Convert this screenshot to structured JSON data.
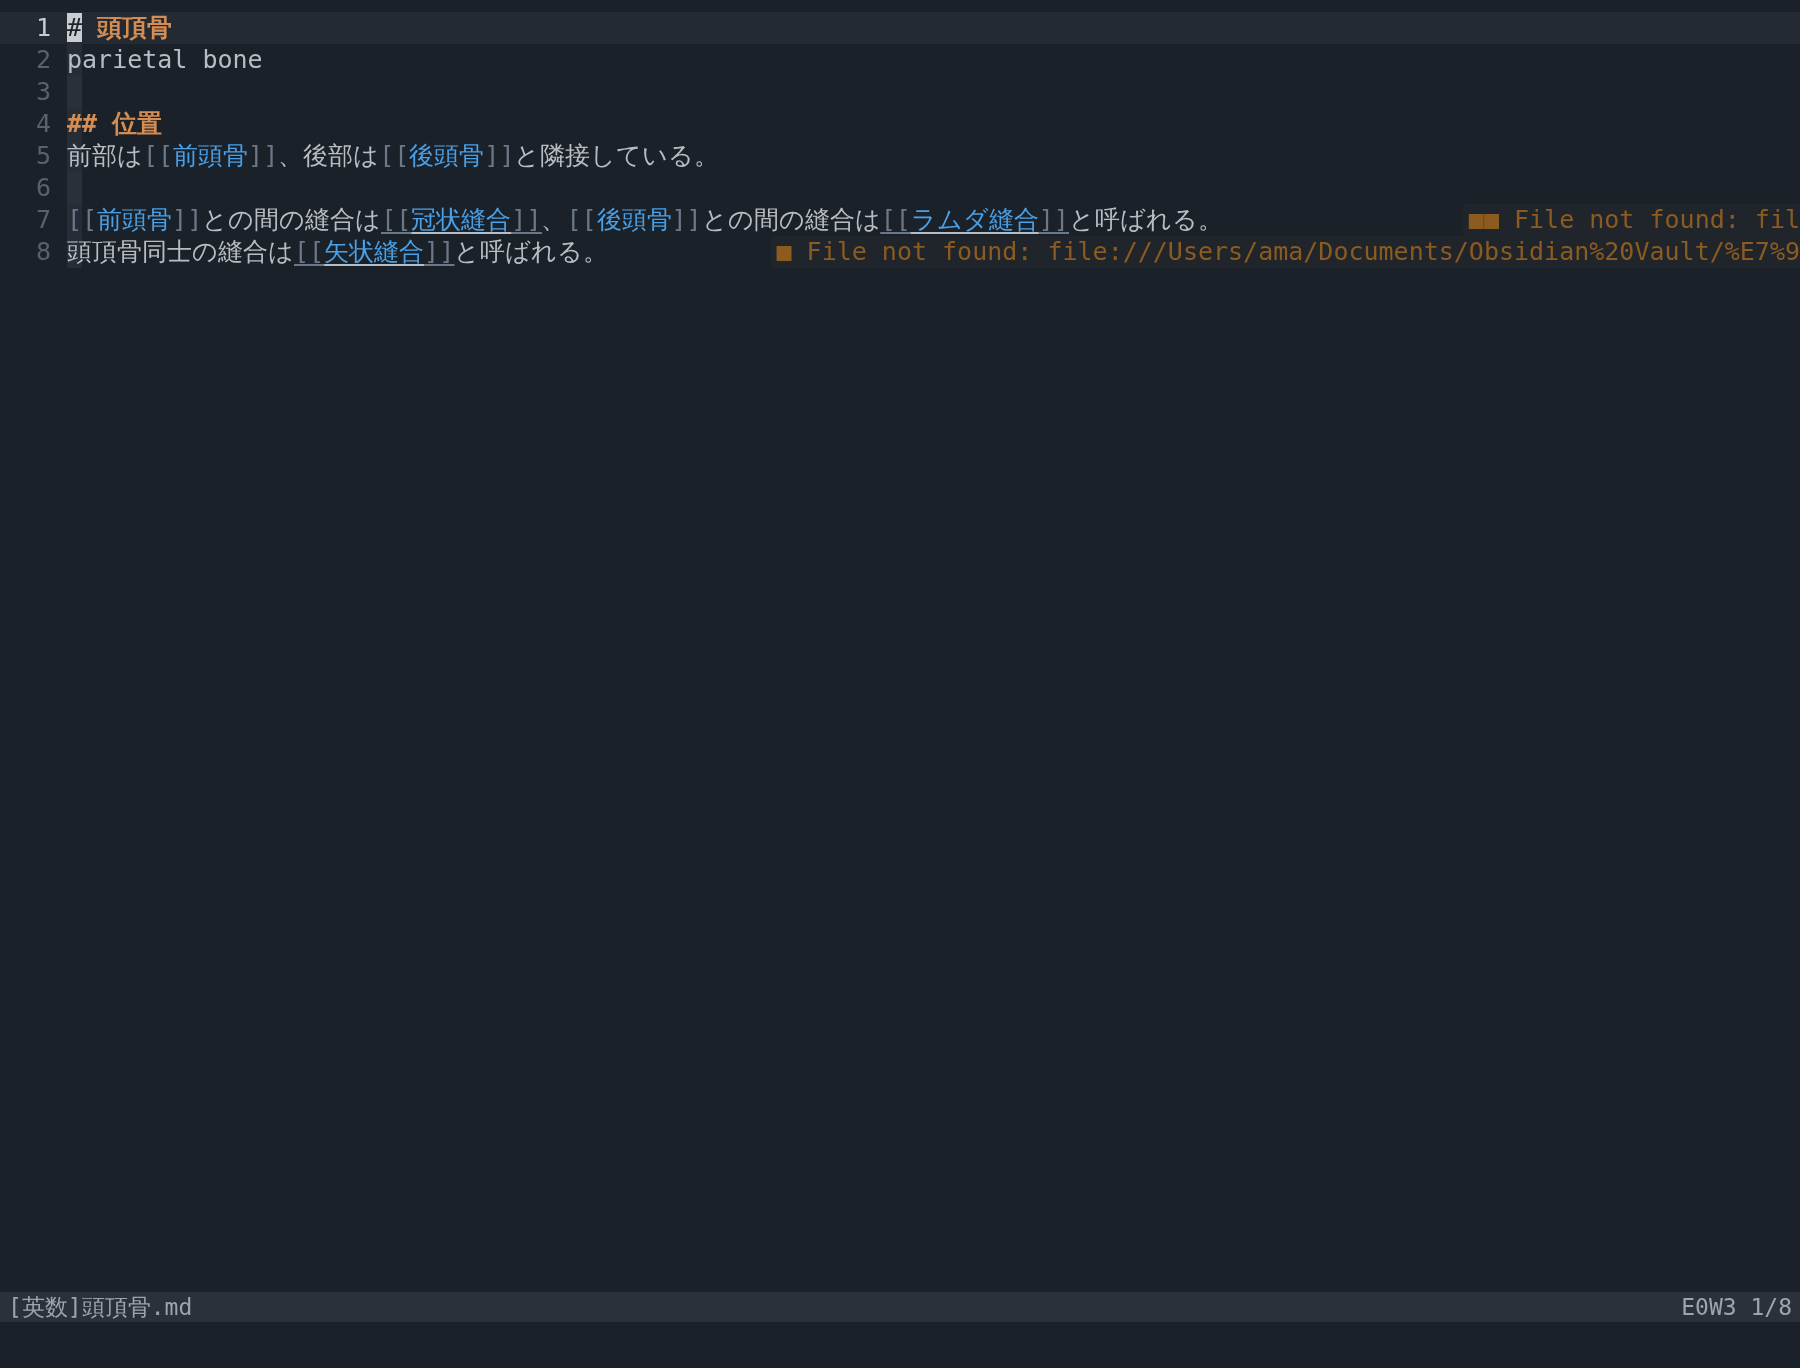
{
  "editor": {
    "cursor_column": true,
    "lines": [
      {
        "number": "1",
        "current": true,
        "segments": [
          {
            "kind": "cursor",
            "text": "#"
          },
          {
            "kind": "heading",
            "text": " 頭頂骨"
          }
        ]
      },
      {
        "number": "2",
        "current": false,
        "segments": [
          {
            "kind": "plain",
            "text": "parietal bone"
          }
        ]
      },
      {
        "number": "3",
        "current": false
      },
      {
        "number": "4",
        "current": false,
        "segments": [
          {
            "kind": "heading",
            "text": "## 位置"
          }
        ]
      },
      {
        "number": "5",
        "current": false,
        "segments": [
          {
            "kind": "plain",
            "text": "前部は"
          },
          {
            "kind": "link",
            "open": "[[",
            "text": "前頭骨",
            "close": "]]",
            "underlined": false
          },
          {
            "kind": "plain",
            "text": "、後部は"
          },
          {
            "kind": "link",
            "open": "[[",
            "text": "後頭骨",
            "close": "]]",
            "underlined": false
          },
          {
            "kind": "plain",
            "text": "と隣接している。"
          }
        ]
      },
      {
        "number": "6",
        "current": false
      },
      {
        "number": "7",
        "current": false,
        "segments": [
          {
            "kind": "link",
            "open": "[[",
            "text": "前頭骨",
            "close": "]]",
            "underlined": false
          },
          {
            "kind": "plain",
            "text": "との間の縫合は"
          },
          {
            "kind": "link",
            "open": "[[",
            "text": "冠状縫合",
            "close": "]]",
            "underlined": true
          },
          {
            "kind": "plain",
            "text": "、"
          },
          {
            "kind": "link",
            "open": "[[",
            "text": "後頭骨",
            "close": "]]",
            "underlined": false
          },
          {
            "kind": "plain",
            "text": "との間の縫合は"
          },
          {
            "kind": "link",
            "open": "[[",
            "text": "ラムダ縫合",
            "close": "]]",
            "underlined": true
          },
          {
            "kind": "plain",
            "text": "と呼ばれる。"
          }
        ],
        "diagnostic": "■■ File not found: fil"
      },
      {
        "number": "8",
        "current": false,
        "segments": [
          {
            "kind": "plain",
            "text": "頭頂骨同士の縫合は"
          },
          {
            "kind": "link",
            "open": "[[",
            "text": "矢状縫合",
            "close": "]]",
            "underlined": true
          },
          {
            "kind": "plain",
            "text": "と呼ばれる。"
          }
        ],
        "diagnostic": "■ File not found: file:///Users/ama/Documents/Obsidian%20Vault/%E7%9"
      }
    ]
  },
  "status_bar": {
    "left": "[英数]頭頂骨.md",
    "right": "E0W3 1/8"
  }
}
